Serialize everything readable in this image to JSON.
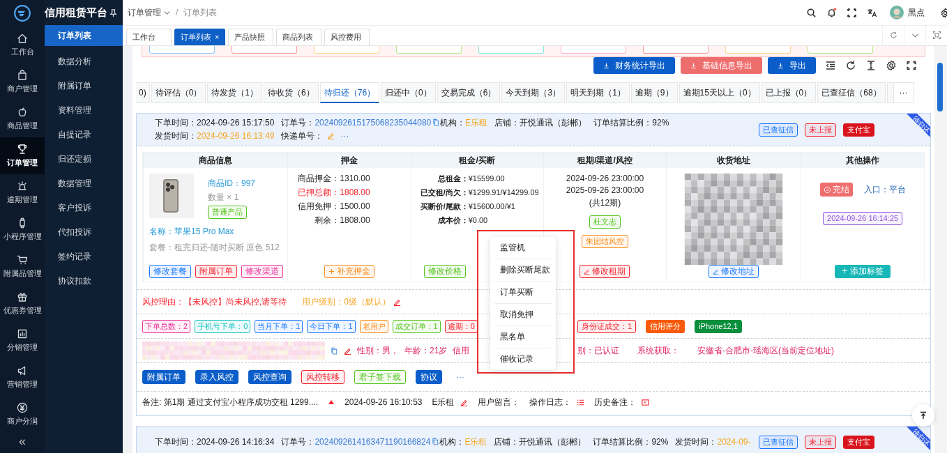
{
  "brand": {
    "title": "信用租赁平台"
  },
  "rail": [
    {
      "label": "工作台",
      "kind": "home",
      "selected": false
    },
    {
      "label": "商户管理",
      "kind": "bag",
      "selected": false
    },
    {
      "label": "商品管理",
      "kind": "apple",
      "selected": false
    },
    {
      "label": "订单管理",
      "kind": "trophy",
      "selected": true
    },
    {
      "label": "逾期管理",
      "kind": "alarm",
      "selected": false
    },
    {
      "label": "小程序管理",
      "kind": "watch",
      "selected": false
    },
    {
      "label": "附属品管理",
      "kind": "cart",
      "selected": false
    },
    {
      "label": "优惠券管理",
      "kind": "gift",
      "selected": false
    },
    {
      "label": "分销管理",
      "kind": "chart",
      "selected": false
    },
    {
      "label": "营销管理",
      "kind": "megaphone",
      "selected": false
    },
    {
      "label": "商户分润",
      "kind": "yen",
      "selected": false
    }
  ],
  "collapse": "«",
  "submenu": [
    {
      "label": "订单列表",
      "selected": true
    },
    {
      "label": "数据分析",
      "selected": false
    },
    {
      "label": "附属订单",
      "selected": false
    },
    {
      "label": "资料管理",
      "selected": false
    },
    {
      "label": "自提记录",
      "selected": false
    },
    {
      "label": "归还定损",
      "selected": false
    },
    {
      "label": "数据管理",
      "selected": false
    },
    {
      "label": "客户投诉",
      "selected": false
    },
    {
      "label": "代扣投诉",
      "selected": false
    },
    {
      "label": "签约记录",
      "selected": false
    },
    {
      "label": "协议扣款",
      "selected": false
    }
  ],
  "breadcrumb": [
    "订单管理",
    "订单列表"
  ],
  "breadcrumb_separator": "/",
  "user": {
    "name": "黑点"
  },
  "page_tabs": [
    {
      "label": "工作台",
      "selected": false
    },
    {
      "label": "订单列表",
      "selected": true,
      "close": "×"
    },
    {
      "label": "产品快照",
      "selected": false
    },
    {
      "label": "商品列表",
      "selected": false
    },
    {
      "label": "风控费用",
      "selected": false
    }
  ],
  "filter_chips": [
    {
      "color": "#91caff"
    },
    {
      "color": "#ff9c9c"
    },
    {
      "color": "#ffd591"
    },
    {
      "color": "#b7eb8f"
    },
    {
      "color": "#87e8de"
    },
    {
      "color": "#ffadd2"
    },
    {
      "color": "#ff9c9c"
    },
    {
      "color": "#ffd591"
    },
    {
      "color": "#b7eb8f"
    }
  ],
  "export_buttons": [
    {
      "label": "财务统计导出",
      "color": "#0b5ec9"
    },
    {
      "label": "基础信息导出",
      "color": "#ee6e6e"
    },
    {
      "label": "导出",
      "color": "#0b5ec9"
    }
  ],
  "status_tabs": [
    {
      "label": "0)",
      "selected": false
    },
    {
      "label": "待评估（0）",
      "selected": false
    },
    {
      "label": "待发货（1）",
      "selected": false
    },
    {
      "label": "待收货（6）",
      "selected": false
    },
    {
      "label": "待归还（76）",
      "selected": true
    },
    {
      "label": "归还中（0）",
      "selected": false
    },
    {
      "label": "交易完成（6）",
      "selected": false
    },
    {
      "label": "今天到期（3）",
      "selected": false
    },
    {
      "label": "明天到期（1）",
      "selected": false
    },
    {
      "label": "逾期（9）",
      "selected": false
    },
    {
      "label": "逾期15天以上（0）",
      "selected": false
    },
    {
      "label": "已上报（0）",
      "selected": false
    },
    {
      "label": "已查征信（68）",
      "selected": false
    }
  ],
  "status_more": "···",
  "orders": [
    {
      "header_fields": [
        {
          "label": "下单时间：",
          "value": "2024-09-26 15:17:50",
          "kind": "plain"
        },
        {
          "label": "订单号：",
          "value": "2024092615175068235044080",
          "kind": "link"
        },
        {
          "label": "机构：",
          "value": "E乐租",
          "kind": "accent"
        },
        {
          "label": "店铺：",
          "value": "开悦通讯（彭郴）",
          "kind": "plain"
        },
        {
          "label": "订单结算比例：",
          "value": "92%",
          "kind": "plain"
        },
        {
          "label": "发货时间：",
          "value": "2024-09-26 16:13:49",
          "kind": "accent"
        },
        {
          "label": "快递单号：",
          "kind": "express"
        }
      ],
      "header_more": "···",
      "badges": [
        {
          "label": "已查征信",
          "color": "#1677ff",
          "solid": false
        },
        {
          "label": "未上报",
          "color": "#f5222d",
          "solid": false
        },
        {
          "label": "支付宝",
          "color": "#d9141c",
          "solid": true
        }
      ],
      "ribbon": "待归还",
      "columns": [
        "商品信息",
        "押金",
        "租金/买断",
        "租期/渠道/风控",
        "收货地址",
        "其他操作"
      ],
      "product": {
        "id": "商品ID：997",
        "qty": "数量 × 1",
        "tag": "普通产品",
        "name": "名称：苹果15 Pro Max",
        "plan": "套餐：租完归还-随时买断 原色 512",
        "buttons": [
          {
            "label": "修改套餐",
            "color": "#1677ff"
          },
          {
            "label": "附属订单",
            "color": "#f5222d"
          },
          {
            "label": "修改渠道",
            "color": "#eb2f96"
          }
        ]
      },
      "deposit": {
        "lines": [
          {
            "label": "商品押金：",
            "value": "1310.00",
            "alert": false
          },
          {
            "label": "已押总额：",
            "value": "1808.00",
            "alert": true
          },
          {
            "label": "信用免押：",
            "value": "1500.00",
            "alert": false
          },
          {
            "label": "剩余：",
            "value": "1808.00",
            "alert": false
          }
        ],
        "button": "补充押金"
      },
      "rent": {
        "lines": [
          {
            "label": "总租金：",
            "value": "¥15599.00"
          },
          {
            "label": "已交租/尚欠：",
            "value": "¥1299.91/¥14299.09"
          },
          {
            "label": "买断价/尾款：",
            "value": "¥15600.00/¥1"
          },
          {
            "label": "成本价：",
            "value": "¥0.00"
          }
        ],
        "button": "修改价格"
      },
      "term": {
        "start": "2024-09-26 23:00:00",
        "end": "2025-09-26 23:00:00",
        "periods": "(共12期)",
        "tags": [
          {
            "label": "杜文志",
            "color": "#52c41a"
          },
          {
            "label": "朱团结风控",
            "color": "#fa8c16"
          }
        ],
        "button": "修改租期"
      },
      "address": {
        "button": "修改地址"
      },
      "other": {
        "finish": "完结",
        "entry": "入口：平台",
        "time_tag": "2024-09-26 16:14:25",
        "button": "添加标签"
      },
      "risk": {
        "reason": "风控理由：【未风控】尚未风控,请等待",
        "level": "用户级别：0级（默认）"
      },
      "stats": [
        {
          "label": "下单总数：2",
          "color": "#eb2f96",
          "solid": false
        },
        {
          "label": "手机号下单：0",
          "color": "#13c2c2",
          "solid": false
        },
        {
          "label": "当月下单：1",
          "color": "#1677ff",
          "solid": false
        },
        {
          "label": "今日下单：1",
          "color": "#1677ff",
          "solid": false
        },
        {
          "label": "老用户",
          "color": "#fa8c16",
          "solid": false
        },
        {
          "label": "成交订单：1",
          "color": "#52c41a",
          "solid": false
        },
        {
          "label": "逾期：0",
          "color": "#f5222d",
          "solid": false
        },
        {
          "label": "身份证成交：1",
          "color": "#f5222d",
          "solid": false
        },
        {
          "label": "信用评分",
          "color": "#fa5a0a",
          "solid": true
        },
        {
          "label": "iPhone12,1",
          "color": "#0a8f3c",
          "solid": true
        }
      ],
      "user_info": [
        "性别：男，",
        "年龄：21岁",
        "信用",
        "别：已认证",
        "系统获取：",
        "安徽省-合肥市-瑶海区(当前定位地址)"
      ],
      "actions": [
        {
          "label": "附属订单",
          "color": "#0b5ec9",
          "solid": true
        },
        {
          "label": "录入风控",
          "color": "#0b5ec9",
          "solid": true
        },
        {
          "label": "风控查询",
          "color": "#0b5ec9",
          "solid": true
        },
        {
          "label": "风控转移",
          "color": "#f5222d",
          "solid": false
        },
        {
          "label": "君子签下载",
          "color": "#52c41a",
          "solid": false
        },
        {
          "label": "协议",
          "color": "#0b5ec9",
          "solid": true
        }
      ],
      "actions_more": "···",
      "remark": {
        "note": "备注: 第1期 通过支付宝小程序成功交租 1299....",
        "time": "2024-09-26 16:10:53",
        "org": "E乐租",
        "message": "用户留言：",
        "log": "操作日志：",
        "history": "历史备注："
      }
    },
    {
      "header_fields": [
        {
          "label": "下单时间：",
          "value": "2024-09-26 14:16:34",
          "kind": "plain"
        },
        {
          "label": "订单号：",
          "value": "2024092614163471190166824",
          "kind": "link"
        },
        {
          "label": "机构：",
          "value": "E乐租",
          "kind": "accent"
        },
        {
          "label": "店铺：",
          "value": "开悦通讯（彭郴）",
          "kind": "plain"
        },
        {
          "label": "订单结算比例：",
          "value": "92%",
          "kind": "plain"
        },
        {
          "label": "发货时间：",
          "value": "2024-09-",
          "kind": "accent"
        }
      ],
      "badges": [
        {
          "label": "已查征信",
          "color": "#1677ff",
          "solid": false
        },
        {
          "label": "未上报",
          "color": "#f5222d",
          "solid": false
        },
        {
          "label": "支付宝",
          "color": "#d9141c",
          "solid": true
        }
      ],
      "ribbon": "待归还"
    }
  ],
  "context_menu": [
    "监管机",
    "删除买断尾款",
    "订单买断",
    "取消免押",
    "黑名单",
    "催收记录"
  ]
}
